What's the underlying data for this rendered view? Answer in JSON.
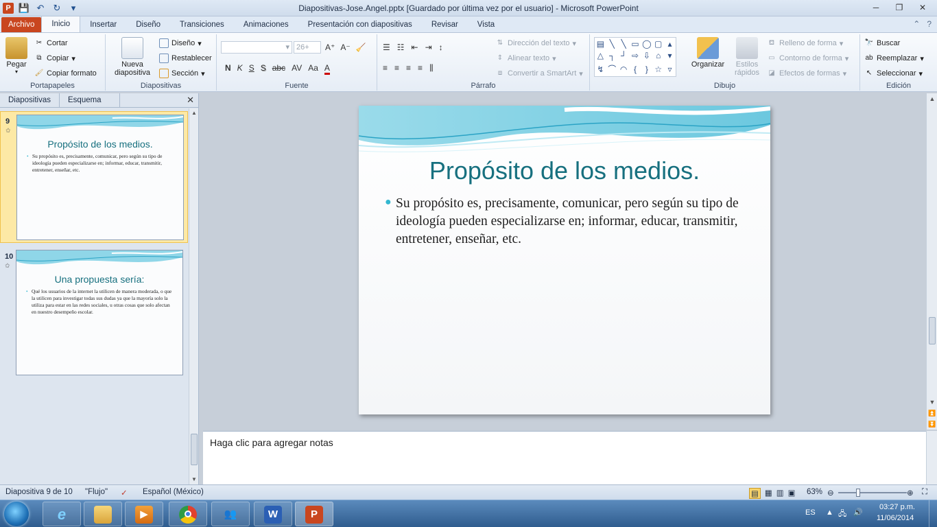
{
  "window": {
    "title": "Diapositivas-Jose.Angel.pptx [Guardado por última vez por el usuario]  -  Microsoft PowerPoint",
    "app_icon": "P"
  },
  "ribbon_tabs": [
    "Archivo",
    "Inicio",
    "Insertar",
    "Diseño",
    "Transiciones",
    "Animaciones",
    "Presentación con diapositivas",
    "Revisar",
    "Vista"
  ],
  "ribbon": {
    "portapapeles": {
      "label": "Portapapeles",
      "pegar": "Pegar",
      "cortar": "Cortar",
      "copiar": "Copiar",
      "copiar_formato": "Copiar formato"
    },
    "diapositivas": {
      "label": "Diapositivas",
      "nueva_1": "Nueva",
      "nueva_2": "diapositiva",
      "diseno": "Diseño",
      "restablecer": "Restablecer",
      "seccion": "Sección"
    },
    "fuente": {
      "label": "Fuente",
      "size": "26+",
      "glyphs": [
        "N",
        "K",
        "S",
        "S",
        "abc",
        "AV",
        "Aa",
        "A"
      ]
    },
    "parrafo": {
      "label": "Párrafo",
      "direccion": "Dirección del texto",
      "alinear": "Alinear texto",
      "convertir": "Convertir a SmartArt"
    },
    "dibujo": {
      "label": "Dibujo",
      "organizar": "Organizar",
      "estilos_1": "Estilos",
      "estilos_2": "rápidos",
      "relleno": "Relleno de forma",
      "contorno": "Contorno de forma",
      "efectos": "Efectos de formas"
    },
    "edicion": {
      "label": "Edición",
      "buscar": "Buscar",
      "reemplazar": "Reemplazar",
      "seleccionar": "Seleccionar"
    }
  },
  "left_panel": {
    "tabs": [
      "Diapositivas",
      "Esquema"
    ],
    "slides": [
      {
        "number": "9",
        "title": "Propósito de los medios.",
        "body": "Su propósito  es, precisamente, comunicar, pero según su tipo de ideología pueden especializarse en; informar, educar, transmitir, entretener, enseñar, etc."
      },
      {
        "number": "10",
        "title": "Una propuesta sería:",
        "body": "Qué los usuarios de la internet la utilicen de manera moderada, o que la utilicen para investigar todas sus dudas ya que la mayoría solo la utiliza para estar en las redes sociales, u otras cosas que solo afectan en nuestro desempeño escolar."
      }
    ]
  },
  "slide": {
    "title": "Propósito de los medios.",
    "body": "Su propósito  es, precisamente, comunicar, pero según su tipo de ideología pueden especializarse en; informar, educar, transmitir, entretener, enseñar, etc."
  },
  "notes": {
    "placeholder": "Haga clic para agregar notas"
  },
  "status": {
    "slide_info": "Diapositiva 9 de 10",
    "theme": "\"Flujo\"",
    "language": "Español (México)",
    "zoom": "63%"
  },
  "taskbar": {
    "lang": "ES",
    "time": "03:27 p.m.",
    "date": "11/06/2014"
  },
  "colors": {
    "accent_title": "#17707f",
    "bullet": "#33b7d0",
    "file_tab": "#c9461f"
  }
}
